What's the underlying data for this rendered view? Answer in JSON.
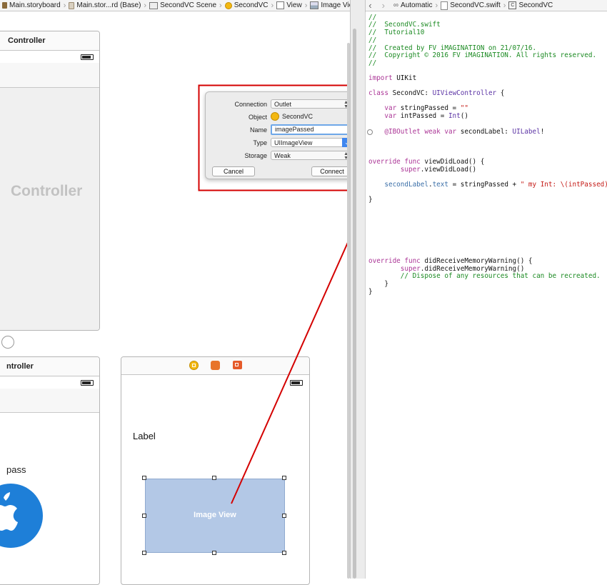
{
  "left_jumpbar": {
    "items": [
      "Main.storyboard",
      "Main.stor...rd (Base)",
      "SecondVC Scene",
      "SecondVC",
      "View",
      "Image View"
    ]
  },
  "right_jumpbar": {
    "mode": "Automatic",
    "file": "SecondVC.swift",
    "symbol": "SecondVC"
  },
  "storyboard": {
    "scene_top_title": "Controller",
    "scene_top_big_title": "Controller",
    "scene_bottom_left_title": "ntroller",
    "partial_text": "pass",
    "second_vc": {
      "label_text": "Label",
      "image_view_text": "Image View"
    }
  },
  "connection_popover": {
    "connection_label": "Connection",
    "connection_value": "Outlet",
    "object_label": "Object",
    "object_value": "SecondVC",
    "name_label": "Name",
    "name_value": "imagePassed",
    "type_label": "Type",
    "type_value": "UIImageView",
    "storage_label": "Storage",
    "storage_value": "Weak",
    "cancel_button": "Cancel",
    "connect_button": "Connect"
  },
  "code": {
    "c1": "//",
    "c2": "//  SecondVC.swift",
    "c3": "//  Tutorial10",
    "c4": "//",
    "c5": "//  Created by FV iMAGINATION on 21/07/16.",
    "c6": "//  Copyright © 2016 FV iMAGINATION. All rights reserved.",
    "c7": "//",
    "import_kw": "import",
    "import_mod": " UIKit",
    "class_kw": "class",
    "class_name": " SecondVC: ",
    "class_super": "UIViewController",
    "class_brace": " {",
    "var1_kw": "    var",
    "var1_rest": " stringPassed = ",
    "var1_str": "\"\"",
    "var2_kw": "    var",
    "var2_rest": " intPassed = ",
    "var2_type": "Int",
    "var2_end": "()",
    "outlet_attr": "    @IBOutlet",
    "outlet_kw": " weak var",
    "outlet_rest": " secondLabel: ",
    "outlet_type": "UILabel",
    "outlet_end": "!",
    "vdl_kw": "override func",
    "vdl_rest": " viewDidLoad() {",
    "vdl_super_kw": "        super",
    "vdl_super_rest": ".viewDidLoad()",
    "assign_a": "    secondLabel",
    "assign_b": ".",
    "assign_c": "text",
    "assign_d": " = stringPassed + ",
    "assign_str": "\" my Int: \\(intPassed)\"",
    "close1": "}",
    "mem_kw": "override func",
    "mem_rest": " didReceiveMemoryWarning() {",
    "mem_super_kw": "        super",
    "mem_super_rest": ".didReceiveMemoryWarning()",
    "mem_comment": "        // Dispose of any resources that can be recreated.",
    "close2": "    }",
    "close3": "}"
  },
  "colors": {
    "annotation_red": "#d40000",
    "image_view_fill": "#b3c8e6",
    "code_keyword": "#ab3596",
    "code_comment": "#1b8a22"
  }
}
